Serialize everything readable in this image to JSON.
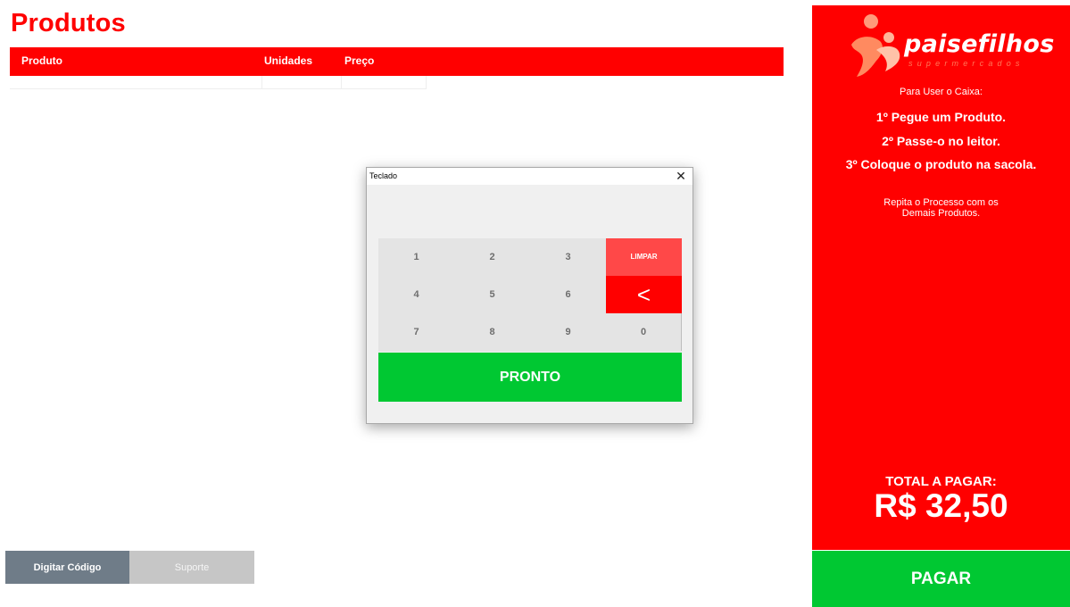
{
  "products": {
    "title": "Produtos",
    "columns": [
      "Produto",
      "Unidades",
      "Preço"
    ]
  },
  "footer": {
    "digitar_label": "Digitar Código",
    "suporte_label": "Suporte"
  },
  "sidebar": {
    "logo_name": "paisefilhos",
    "logo_sub": "supermercados",
    "instructions_title": "Para User o Caixa:",
    "steps": [
      "1º  Pegue um Produto.",
      "2º Passe-o no leitor.",
      "3º Coloque o produto na sacola."
    ],
    "repeat_line1": "Repita o Processo com os",
    "repeat_line2": "Demais Produtos.",
    "total_label": "TOTAL A PAGAR:",
    "total_value": "R$ 32,50",
    "pay_label": "PAGAR"
  },
  "keypad_dialog": {
    "title": "Teclado",
    "close_glyph": "✕",
    "keys": {
      "k1": "1",
      "k2": "2",
      "k3": "3",
      "k4": "4",
      "k5": "5",
      "k6": "6",
      "k7": "7",
      "k8": "8",
      "k9": "9",
      "k0": "0",
      "clear": "LIMPAR",
      "backspace": "<"
    },
    "done_label": "PRONTO"
  },
  "colors": {
    "brand_red": "#ff0000",
    "confirm_green": "#00c832",
    "clear_key": "#ff4848",
    "digitar_button": "#6f7c88",
    "suporte_button": "#c6c6c6"
  },
  "icons": {
    "dialog_close": "close-icon",
    "backspace": "backspace-icon",
    "logo_mark": "family-logo-icon"
  }
}
